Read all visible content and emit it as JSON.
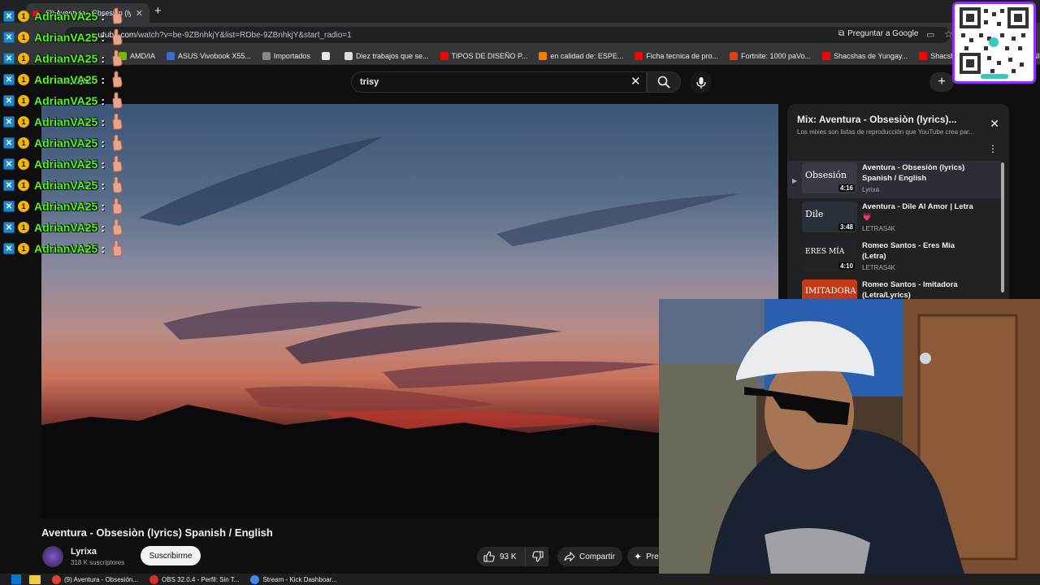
{
  "browser": {
    "active_tab_title": "(9) Aventura - Obsesiòn (lyrics)",
    "url_host": "youtube.com",
    "url_path": "/watch?v=be-9ZBnhkjY&list=RDbe-9ZBnhkjY&start_radio=1",
    "ask_google": "Preguntar a Google",
    "bookmarks": [
      {
        "label": "AMD/IA",
        "color": "#76b900"
      },
      {
        "label": "ASUS Vivobook X55...",
        "color": "#3a6bd1"
      },
      {
        "label": "Importados",
        "color": "#888888"
      },
      {
        "label": "",
        "color": "#e8e8e8"
      },
      {
        "label": "Diez trabajos que se...",
        "color": "#dddddd"
      },
      {
        "label": "TIPOS DE DISEÑO P...",
        "color": "#ff0000"
      },
      {
        "label": "en calidad de: ESPE...",
        "color": "#f57c00"
      },
      {
        "label": "Ficha tecnica de pro...",
        "color": "#ff0000"
      },
      {
        "label": "Fortnite: 1000 paVo...",
        "color": "#d84315"
      },
      {
        "label": "Shacshas de Yungay...",
        "color": "#ff0000"
      },
      {
        "label": "Shacshas de Huaraz...",
        "color": "#ff0000"
      },
      {
        "label": "UNI",
        "color": "#c62828"
      }
    ]
  },
  "youtube": {
    "logo_text": "YouTube",
    "search_query": "trisy",
    "video_title": "Aventura - Obsesiòn (lyrics) Spanish / English",
    "channel_name": "Lyrixa",
    "channel_subs": "318 K suscriptores",
    "subscribe_label": "Suscribirme",
    "likes": "93 K",
    "share_label": "Compartir",
    "more_label": "Pre",
    "playlist": {
      "title": "Mix: Aventura - Obsesiòn (lyrics)...",
      "subtitle": "Los mixes son listas de reproducción que YouTube crea par...",
      "items": [
        {
          "idx": "▶",
          "title_line1": "Aventura - Obsesiòn (lyrics)",
          "title_line2": "Spanish / English",
          "channel": "Lyrixa",
          "duration": "4:16",
          "thumb_label": "Obsesión",
          "thumb_color": "#3a3a45"
        },
        {
          "idx": "",
          "title_line1": "Aventura - Dile Al Amor | Letra",
          "title_line2": "💗",
          "channel": "LETRAS4K",
          "duration": "3:48",
          "thumb_label": "Dile",
          "thumb_color": "#2a3038"
        },
        {
          "idx": "",
          "title_line1": "Romeo Santos - Eres Mía",
          "title_line2": "(Letra)",
          "channel": "LETRAS4K",
          "duration": "4:10",
          "thumb_label": "ERES MÍA",
          "thumb_color": "#222428"
        },
        {
          "idx": "",
          "title_line1": "Romeo Santos - Imitadora",
          "title_line2": "(Letra/Lyrics)",
          "channel": "",
          "duration": "",
          "thumb_label": "IMITADORA",
          "thumb_color": "#c23a16"
        }
      ]
    }
  },
  "chat": {
    "user": "AdrianVA25",
    "colon": ":",
    "badge_number": "1",
    "lines": 12
  },
  "taskbar": {
    "items": [
      {
        "label": "(9) Aventura - Obsesión..."
      },
      {
        "label": "OBS 32.0.4 - Perfil: Sin T..."
      },
      {
        "label": "Stream - Kick Dashboar..."
      }
    ]
  }
}
